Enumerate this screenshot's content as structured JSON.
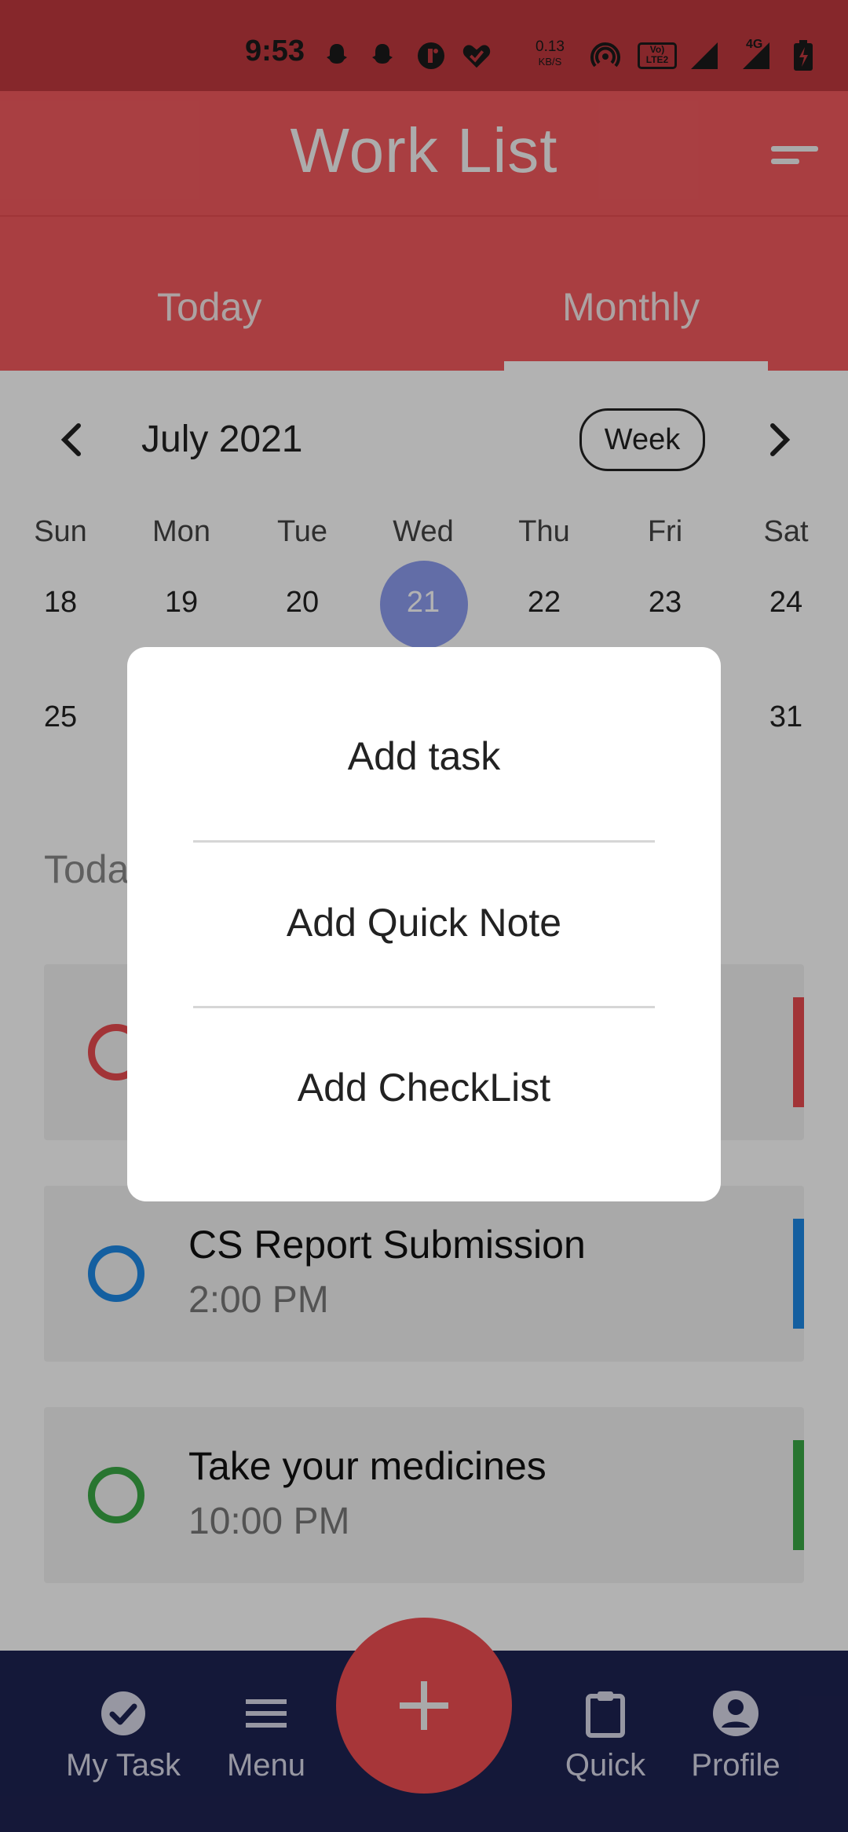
{
  "status_bar": {
    "time": "9:53",
    "speed_value": "0.13",
    "speed_unit": "KB/S",
    "volte": "Vo) LTE2",
    "network": "4G",
    "icons": [
      "snapchat-icon",
      "snapchat-icon",
      "app-icon",
      "heart-icon",
      "hotspot-icon",
      "signal-icon",
      "signal-icon",
      "battery-icon"
    ]
  },
  "header": {
    "title": "Work List",
    "filter_icon": "filter-icon"
  },
  "tabs": [
    {
      "label": "Today",
      "selected": false
    },
    {
      "label": "Monthly",
      "selected": true
    }
  ],
  "calendar": {
    "month_label": "July 2021",
    "week_button": "Week",
    "weekdays": [
      "Sun",
      "Mon",
      "Tue",
      "Wed",
      "Thu",
      "Fri",
      "Sat"
    ],
    "row1": [
      "18",
      "19",
      "20",
      "21",
      "22",
      "23",
      "24"
    ],
    "row2_first": "25",
    "row2_last": "31",
    "selected_date": "21"
  },
  "section_label": "Toda",
  "tasks": [
    {
      "title": "",
      "time": "",
      "color": "#e84b4f"
    },
    {
      "title": "CS Report Submission",
      "time": "2:00 PM",
      "color": "#1e88e5"
    },
    {
      "title": "Take your medicines",
      "time": "10:00 PM",
      "color": "#3aa845"
    }
  ],
  "dialog": {
    "items": [
      "Add task",
      "Add Quick Note",
      "Add CheckList"
    ]
  },
  "bottom_nav": {
    "items": [
      {
        "label": "My Task",
        "icon": "check-circle-icon"
      },
      {
        "label": "Menu",
        "icon": "menu-icon"
      },
      {
        "label": "Quick",
        "icon": "clipboard-icon"
      },
      {
        "label": "Profile",
        "icon": "profile-icon"
      }
    ],
    "fab_icon": "plus-icon"
  },
  "colors": {
    "primary": "#f25a5e",
    "nav_bg": "#1e2352",
    "today_circle": "#8d9cf0"
  }
}
